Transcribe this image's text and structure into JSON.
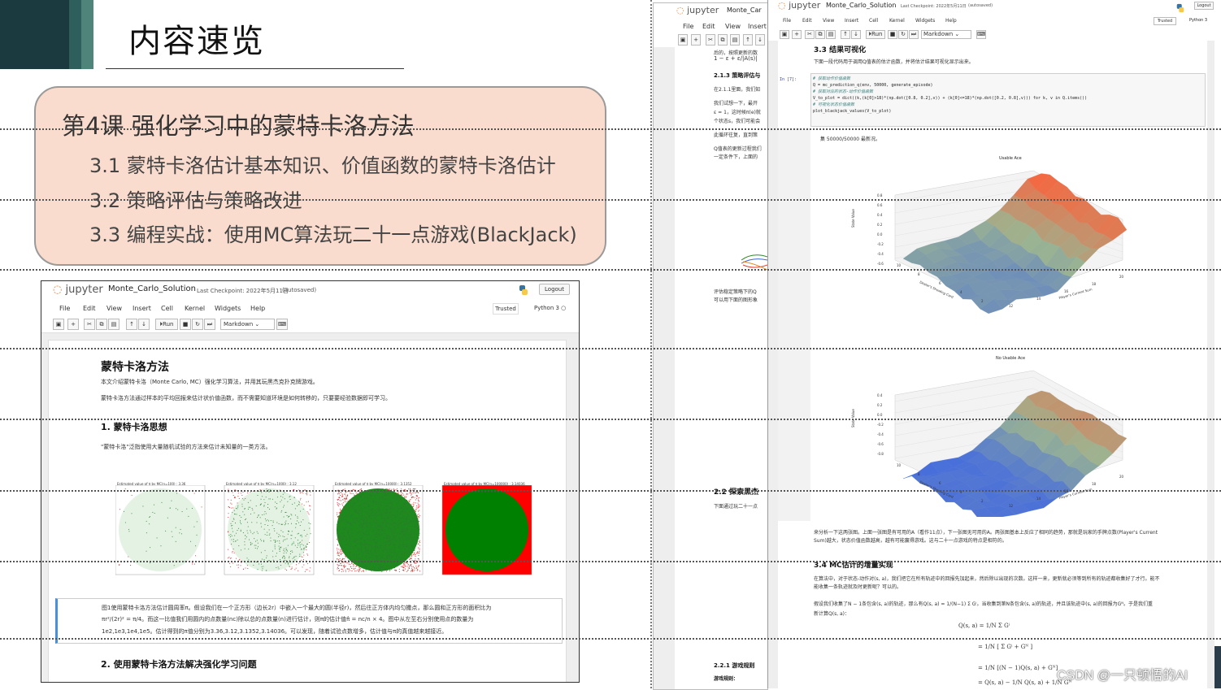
{
  "slide": {
    "title": "内容速览",
    "lesson_title": "第4课 强化学习中的蒙特卡洛方法",
    "items": [
      "3.1 蒙特卡洛估计基本知识、价值函数的蒙特卡洛估计",
      "3.2 策略评估与策略改进",
      "3.3 编程实战：使用MC算法玩二十一点游戏(BlackJack)"
    ],
    "colors": {
      "bar_dark": "#1b3a40",
      "bar_mid": "#2e5f5c",
      "bar_light": "#4e8479",
      "box_fill": "#f9dccd"
    }
  },
  "notebook_left": {
    "logo": "jupyter",
    "name": "Monte_Carlo_Solution",
    "checkpoint": "Last Checkpoint: 2022年5月11日",
    "autosaved": "(autosaved)",
    "logout": "Logout",
    "menu": [
      "File",
      "Edit",
      "View",
      "Insert",
      "Cell",
      "Kernel",
      "Widgets",
      "Help"
    ],
    "trusted": "Trusted",
    "kernel": "Python 3",
    "toolbar": {
      "run": "Run",
      "celltype": "Markdown"
    },
    "heading": "蒙特卡洛方法",
    "intro1": "本文介绍蒙特卡洛（Monte Carlo, MC）强化学习算法，并用其玩黑杰克扑克牌游戏。",
    "intro2": "蒙特卡洛方法通过样本的平均回报来估计状价值函数，而不需要知道环境是如何转移的，只要要经验数据即可学习。",
    "sec1": "1. 蒙特卡洛思想",
    "sec1_text": "\"蒙特卡洛\"泛指使用大量随机试验的方法来估计未知量的一类方法。",
    "plot_titles": [
      "Estimated value of π by MC(n=100) : 3.36",
      "Estimated value of π by MC(n=1000) : 3.12",
      "Estimated value of π by MC(n=10000) : 3.1352",
      "Estimated value of π by MC(n=100000) : 3.14036"
    ],
    "caption_l1": "图1使用蒙特卡洛方法估计圆周率π。假设我们在一个正方形（边长2r）中嵌入一个最大的圆(半径r)，然后往正方体内均匀撒点，那么圆和正方形的面积比为",
    "caption_l2": "πr²/(2r)² = π/4。而这一比值我们用圆内的点数量(nc)除以总的点数量(n)进行估计，则π的估计值π̂ = nc/n × 4。图中从左至右分别使用点的数量为",
    "caption_l3": "1e2,1e3,1e4,1e5。估计得到的π值分别为3.36,3.12,3.1352,3.14036。可以发现，随着试验点数增多，估计值与π的真值越来越接近。",
    "sec2": "2. 使用蒙特卡洛方法解决强化学习问题"
  },
  "notebook_mid": {
    "logo": "jupyter",
    "name": "Monte_Car",
    "menu": [
      "File",
      "Edit",
      "View",
      "Insert"
    ],
    "line1": "后的，按照更新的数",
    "formula": "1 − ε + ε/|A(s)|",
    "sec_a": "2.1.3 策略评估与",
    "t1": "在2.1.1里面，我们知",
    "t2": "我们试想一下，最开",
    "t3": "ε = 1，这时候π(e)就",
    "t4": "个状态s，我们可能会",
    "t5": "此循环往复，直到策",
    "t6": "Q值表的更新过程我们",
    "t7": "一定条件下，上面的",
    "t8": "评估稳定策略下的Q",
    "t9": "可以用下面的图形象",
    "sec_b": "2.2 探索黑杰",
    "t10": "下面通过玩二十一点",
    "sec_c": "2.2.1 游戏规则",
    "t11": "游戏规则："
  },
  "notebook_right": {
    "logo": "jupyter",
    "name": "Monte_Carlo_Solution",
    "checkpoint": "Last Checkpoint: 2022年5月11日",
    "autosaved": "(autosaved)",
    "logout": "Logout",
    "menu": [
      "File",
      "Edit",
      "View",
      "Insert",
      "Cell",
      "Kernel",
      "Widgets",
      "Help"
    ],
    "trusted": "Trusted",
    "kernel": "Python 3",
    "toolbar": {
      "run": "Run",
      "celltype": "Markdown"
    },
    "sec33": "3.3 结果可视化",
    "sec33_text": "下面一段代码用于调用Q值表的估计函数，并将估计结果可视化显示出来。",
    "prompt": "In  [7]:",
    "code": [
      "# 获取动作价值函数",
      "Q = mc_prediction_q(env, 50000, generate_episode)",
      "",
      "# 获取对应的状态-动作价值函数",
      "V_to_plot = dict((k,(k[0]>18)*(np.dot([0.8, 0.2],v)) + (k[0]<=18)*(np.dot([0.2, 0.8],v))) for k, v in Q.items())",
      "",
      "# 可视化状态价值函数",
      "plot_blackjack_values(V_to_plot)"
    ],
    "progress": "集 50000/50000 最新况。",
    "plot1_title": "Usable Ace",
    "plot2_title": "No Usable Ace",
    "axis_x": "Player's Current Sum",
    "axis_y": "Dealer's Showing Card",
    "axis_z": "State Value",
    "plot1_zticks": [
      "0.8",
      "0.6",
      "0.4",
      "0.2",
      "0.0",
      "-0.2",
      "-0.4",
      "-0.6"
    ],
    "plot2_zticks": [
      "0.4",
      "0.2",
      "0.0",
      "-0.2",
      "-0.4",
      "-0.6",
      "-0.8"
    ],
    "xticks": [
      "12",
      "14",
      "16",
      "18",
      "20"
    ],
    "yticks": [
      "10",
      "8",
      "6",
      "4",
      "2"
    ],
    "analysis1": "来分析一下这两张图。上面一张图是有可用的A（看作11点），下一张图无可用的A。两张图基本上反应了相同的趋势，那就是玩家的手牌点数(Player's Current",
    "analysis2": "Sum)越大，状态价值函数越高，越有可能赢得游戏。这与二十一点游戏的特点是相符的。",
    "sec34": "3.4 MC估计的增量实现",
    "sec34_t1": "在算法中，对于状态-动作对(s, a)，我们把它在所有轨迹中的回报先加起来，然后除以出现的次数。这样一来，更新就必须等到所有的轨迹都收集好了才行。能不",
    "sec34_t2": "能收集一条轨迹就及时更新呢？可以的。",
    "sec34_t3": "假设我们收集了N − 1条包含(s, a)的轨迹，那么有Q(s, a) = 1/(N−1) Σ Gⁱ。当收集到第N条包含(s, a)的轨迹，并且该轨迹中(s, a)的回报为Gᴺ。于是我们重",
    "sec34_t4": "新计算Q(s, a)：",
    "eq": [
      "Q(s, a) = 1/N Σ Gⁱ",
      "= 1/N [ Σ Gⁱ + Gᴺ ]",
      "= 1/N [(N − 1)Q(s, a) + Gᴺ]",
      "= Q(s, a) − 1/N Q(s, a) + 1/N Gᴺ"
    ]
  },
  "watermark": "CSDN @一只顿悟的AI"
}
